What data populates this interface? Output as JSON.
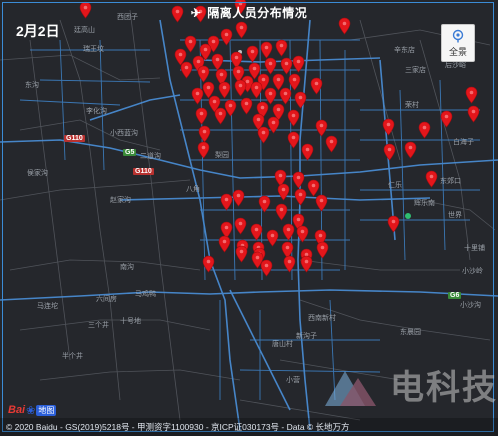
{
  "title": "隔离人员分布情况",
  "date": "2月2日",
  "fullview_label": "全景",
  "copyright": "© 2020 Baidu - GS(2019)5218号 - 甲测资字1100930 - 京ICP证030173号 - Data © 长地万方",
  "logo": {
    "brand_left": "Bai",
    "brand_right": "地图"
  },
  "watermark": {
    "main": "电科技",
    "sub": ""
  },
  "colors": {
    "pin": "#e3161b",
    "roads": "#4a90d9",
    "background": "#25272c",
    "border": "#3b8cd6"
  },
  "places": [
    {
      "name": "西团子"
    },
    {
      "name": "廷高山"
    },
    {
      "name": "瑞王坟"
    },
    {
      "name": "东沟"
    },
    {
      "name": "李化沟"
    },
    {
      "name": "小西蓝沟"
    },
    {
      "name": "二道沟"
    },
    {
      "name": "侯家沟"
    },
    {
      "name": "赵家沟"
    },
    {
      "name": "南沟"
    },
    {
      "name": "马鸡鸭"
    },
    {
      "name": "六间房"
    },
    {
      "name": "马连坨"
    },
    {
      "name": "十号地"
    },
    {
      "name": "三个井"
    },
    {
      "name": "半个井"
    },
    {
      "name": "梨园"
    },
    {
      "name": "八角"
    },
    {
      "name": "辛东店"
    },
    {
      "name": "三家店"
    },
    {
      "name": "荣村"
    },
    {
      "name": "东郊口"
    },
    {
      "name": "仁乐"
    },
    {
      "name": "辉乐南"
    },
    {
      "name": "世界"
    },
    {
      "name": "白海子"
    },
    {
      "name": "后沙峪"
    },
    {
      "name": "十里铺"
    },
    {
      "name": "小沙岭"
    },
    {
      "name": "小沙沟"
    },
    {
      "name": "西南新村"
    },
    {
      "name": "新沟子"
    },
    {
      "name": "东晨园"
    },
    {
      "name": "小营"
    },
    {
      "name": "唐山村"
    }
  ],
  "road_shields": [
    {
      "label": "G110"
    },
    {
      "label": "G5"
    },
    {
      "label": "G110"
    },
    {
      "label": "G6"
    }
  ],
  "markers_count": 95
}
